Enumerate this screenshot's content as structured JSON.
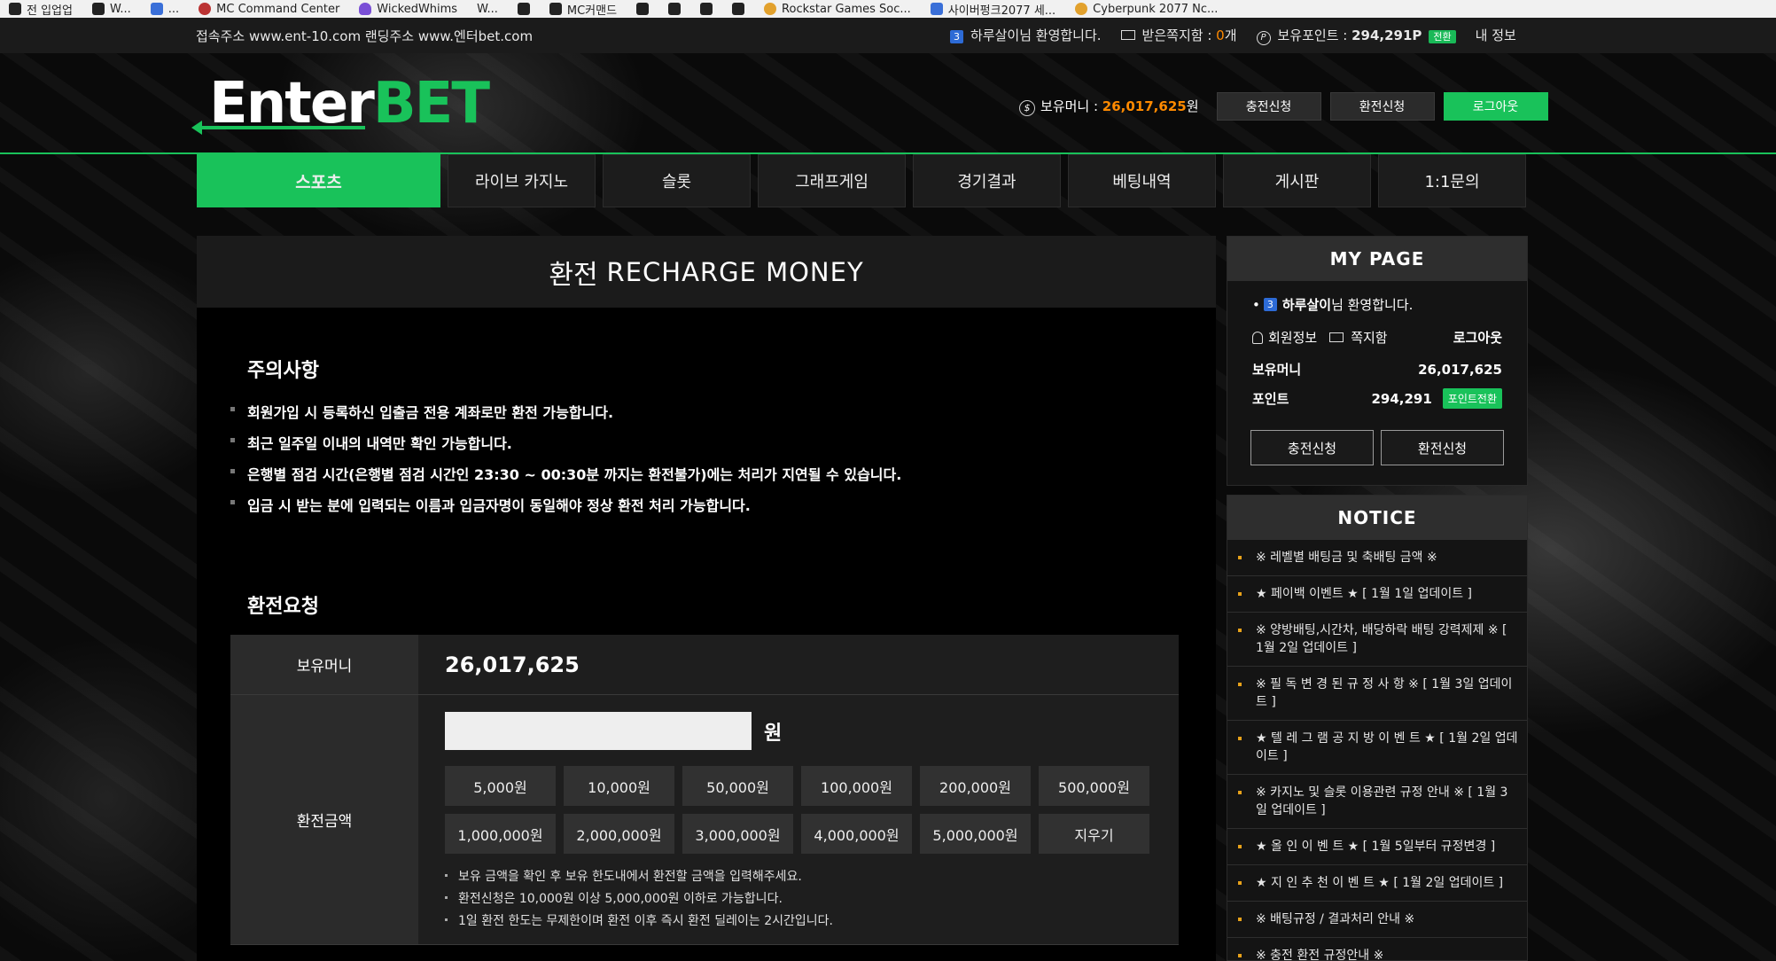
{
  "bookmarks": [
    {
      "label": "전 입업업",
      "icon": "bookmark-icon"
    },
    {
      "label": "W...",
      "icon": "bookmark-icon"
    },
    {
      "label": "...",
      "icon": "bookmark-icon"
    },
    {
      "label": "MC Command Center",
      "icon": "mc-icon"
    },
    {
      "label": "WickedWhims",
      "icon": "shield-icon"
    },
    {
      "label": "W...",
      "icon": "bookmark-icon"
    },
    {
      "label": "",
      "icon": "bookmark-icon"
    },
    {
      "label": "MC커맨드",
      "icon": "bookmark-icon"
    },
    {
      "label": "",
      "icon": "bookmark-icon"
    },
    {
      "label": "",
      "icon": "bookmark-icon"
    },
    {
      "label": "",
      "icon": "bookmark-icon"
    },
    {
      "label": "",
      "icon": "bookmark-icon"
    },
    {
      "label": "Rockstar Games Soc...",
      "icon": "rockstar-icon"
    },
    {
      "label": "사이버펑크2077 세...",
      "icon": "blue-icon"
    },
    {
      "label": "Cyberpunk 2077 Nc...",
      "icon": "cyberpunk-icon"
    }
  ],
  "topbar": {
    "address": "접속주소 www.ent-10.com 랜딩주소 www.엔터bet.com",
    "level": "3",
    "welcome": "하루살이님 환영합니다.",
    "messages_label": "받은쪽지함 : ",
    "messages_count": "0",
    "messages_unit": "개",
    "points_label": "보유포인트 : ",
    "points_value": "294,291P",
    "switch_label": "전환",
    "myinfo": "내 정보"
  },
  "header": {
    "logo_enter": "Enter",
    "logo_bet": "BET",
    "money_label": "보유머니 : ",
    "money_value": "26,017,625",
    "money_unit": "원",
    "charge_btn": "충전신청",
    "exchange_btn": "환전신청",
    "logout_btn": "로그아웃"
  },
  "nav": {
    "items": [
      "스포츠",
      "라이브 카지노",
      "슬롯",
      "그래프게임",
      "경기결과",
      "베팅내역",
      "게시판",
      "1:1문의"
    ]
  },
  "main": {
    "title_kr": "환전",
    "title_en": "RECHARGE MONEY",
    "notice_heading": "주의사항",
    "notices": [
      "회원가입 시 등록하신 입출금 전용 계좌로만 환전 가능합니다.",
      "최근 일주일 이내의 내역만 확인 가능합니다.",
      "은행별 점검 시간(은행별 점검 시간인 23:30 ~ 00:30분 까지는 환전불가)에는 처리가 지연될 수 있습니다.",
      "입금 시 받는 분에 입력되는 이름과 입금자명이 동일해야 정상 환전 처리 가능합니다."
    ],
    "request_heading": "환전요청",
    "form": {
      "money_label": "보유머니",
      "money_value": "26,017,625",
      "amount_label": "환전금액",
      "amount_value": "",
      "won": "원",
      "chips": [
        "5,000원",
        "10,000원",
        "50,000원",
        "100,000원",
        "200,000원",
        "500,000원",
        "1,000,000원",
        "2,000,000원",
        "3,000,000원",
        "4,000,000원",
        "5,000,000원",
        "지우기"
      ],
      "hints": [
        "보유 금액을 확인 후 보유 한도내에서 환전할 금액을 입력해주세요.",
        "환전신청은 10,000원 이상 5,000,000원 이하로 가능합니다.",
        "1일 환전 한도는 무제한이며 환전 이후 즉시 환전 딜레이는 2시간입니다."
      ]
    }
  },
  "mypage": {
    "title": "MY PAGE",
    "level": "3",
    "username": "하루살이",
    "welcome_suffix": "님 환영합니다.",
    "member_info": "회원정보",
    "mailbox": "쪽지함",
    "logout": "로그아웃",
    "money_label": "보유머니",
    "money_value": "26,017,625",
    "point_label": "포인트",
    "point_value": "294,291",
    "point_switch": "포인트전환",
    "charge_btn": "충전신청",
    "exchange_btn": "환전신청"
  },
  "notice": {
    "title": "NOTICE",
    "items": [
      "※ 레벨별 배팅금 및 축배팅 금액 ※",
      "★ 페이백 이벤트 ★ [ 1월 1일 업데이트 ]",
      "※ 양방배팅,시간차, 배당하락 배팅 강력제제 ※ [ 1월 2일 업데이트 ]",
      "※ 필 독 변 경 된 규 정 사 항 ※ [ 1월 3일 업데이트 ]",
      "★ 텔 레 그 램 공 지 방 이 벤 트 ★ [ 1월 2일 업데이트 ]",
      "※ 카지노 및 슬롯 이용관련 규정 안내 ※ [ 1월 3일 업데이트 ]",
      "★ 올 인 이 벤 트 ★ [ 1월 5일부터 규정변경 ]",
      "★ 지 인 추 천 이 벤 트 ★ [ 1월 2일 업데이트 ]",
      "※ 배팅규정 / 결과처리 안내 ※",
      "※ 충전 환전 규정안내 ※"
    ]
  },
  "colors": {
    "accent": "#19c25a",
    "money": "#ff8a00",
    "panel": "#1e1e1e",
    "label_bg": "#2b2b2b"
  }
}
